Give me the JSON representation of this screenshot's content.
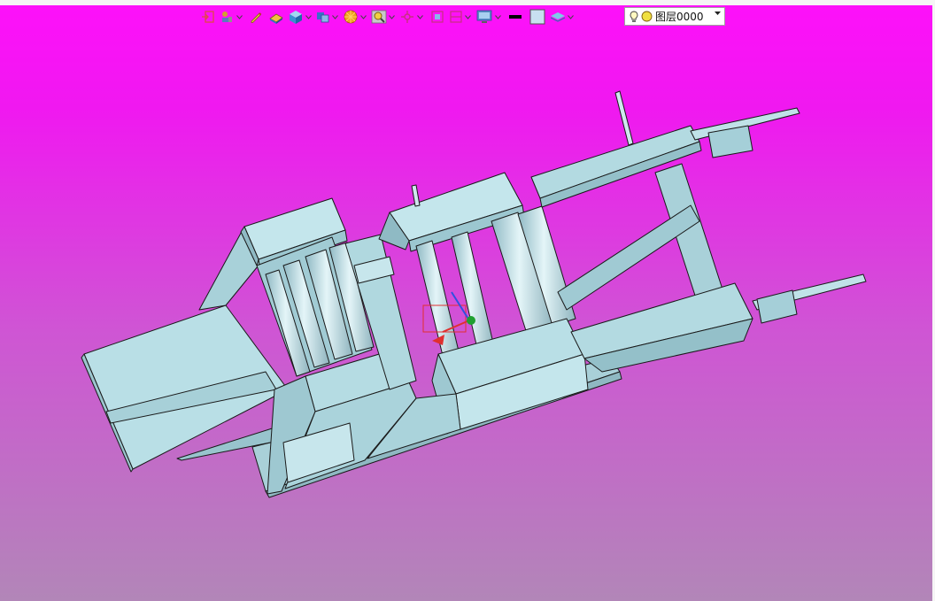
{
  "toolbar": {
    "buttons": [
      {
        "name": "exit-sketch-icon",
        "has_dropdown": false
      },
      {
        "name": "user-tool-icon",
        "has_dropdown": true
      },
      {
        "name": "pencil-icon",
        "has_dropdown": false
      },
      {
        "name": "eraser-icon",
        "has_dropdown": false
      },
      {
        "name": "cube-icon",
        "has_dropdown": true
      },
      {
        "name": "copy-object-icon",
        "has_dropdown": true
      },
      {
        "name": "render-style-icon",
        "has_dropdown": true
      },
      {
        "name": "zoom-icon",
        "has_dropdown": true
      },
      {
        "name": "pan-icon",
        "has_dropdown": true
      },
      {
        "name": "fit-view-icon",
        "has_dropdown": false
      },
      {
        "name": "section-view-icon",
        "has_dropdown": true
      },
      {
        "name": "display-settings-icon",
        "has_dropdown": true
      },
      {
        "name": "line-color-icon",
        "has_dropdown": false
      },
      {
        "name": "fill-color-icon",
        "has_dropdown": false
      },
      {
        "name": "layer-manager-icon",
        "has_dropdown": true
      }
    ],
    "line_color": "#000000",
    "fill_color": "#c8dff0"
  },
  "layer": {
    "current": "图层0000",
    "visible_icon": "lightbulb-icon",
    "color_icon": "yellow-circle-icon"
  },
  "viewport": {
    "background_top": "#fe10fa",
    "background_bottom": "#b286b8",
    "model_color": "#b9dfe6"
  }
}
